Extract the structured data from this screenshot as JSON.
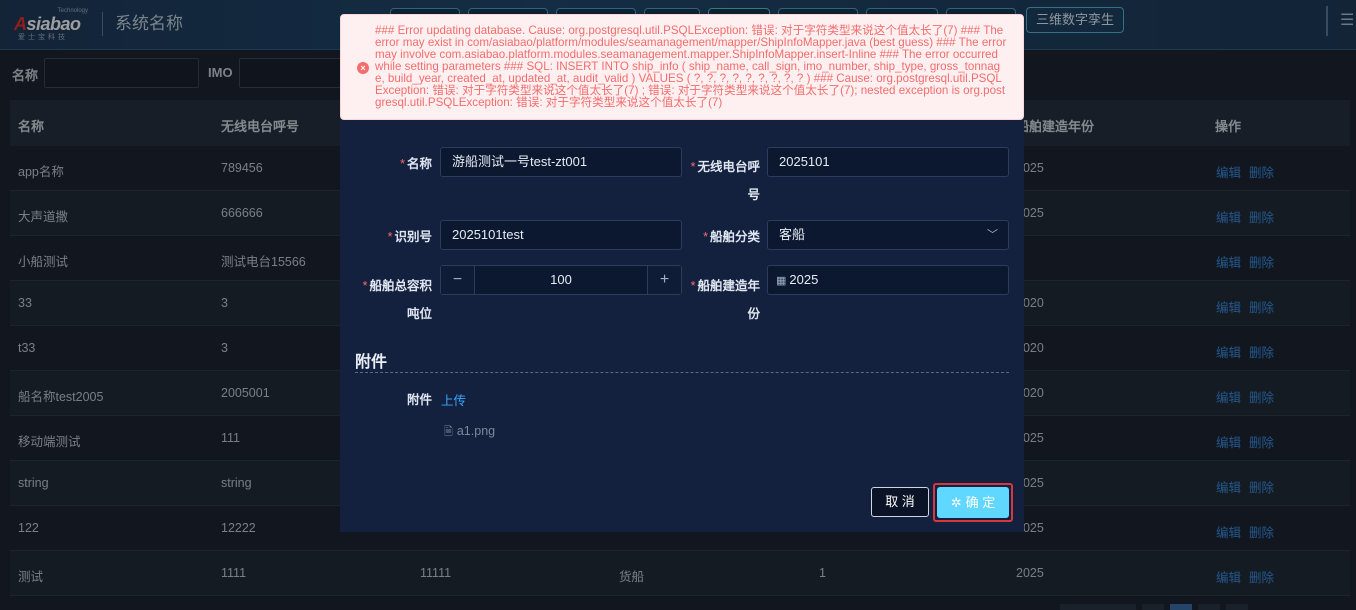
{
  "header": {
    "logo_text": "Asiabao",
    "logo_sub": "爱士宝科技",
    "logo_tech": "Technology",
    "system_name": "系统名称",
    "nav_last": "三维数字孪生"
  },
  "search": {
    "name_label": "名称",
    "imo_label": "IMO"
  },
  "table": {
    "headers": [
      "名称",
      "无线电台呼号",
      "",
      "",
      "",
      "船舶建造年份",
      "操作"
    ],
    "rows": [
      {
        "name": "app名称",
        "call": "789456",
        "year": "2025"
      },
      {
        "name": "大声道撒",
        "call": "666666",
        "year": "2025"
      },
      {
        "name": "小船测试",
        "call": "测试电台15566",
        "year": ""
      },
      {
        "name": "33",
        "call": "3",
        "year": "2020"
      },
      {
        "name": "t33",
        "call": "3",
        "year": "2020"
      },
      {
        "name": "船名称test2005",
        "call": "2005001",
        "year": "2020"
      },
      {
        "name": "移动端测试",
        "call": "111",
        "year": "2025"
      },
      {
        "name": "string",
        "call": "string",
        "year": "2025"
      },
      {
        "name": "122",
        "call": "12222",
        "year": "2025"
      }
    ],
    "last_row": {
      "name": "测试",
      "call": "1111",
      "id": "11111",
      "type": "货船",
      "tonnage": "1",
      "year": "2025"
    },
    "edit_label": "编辑",
    "delete_label": "删除"
  },
  "dialog": {
    "name_label": "名称",
    "name_value": "游船测试一号test-zt001",
    "call_label_1": "无线电台呼",
    "call_label_2": "号",
    "call_value": "2025101",
    "id_label": "识别号",
    "id_value": "2025101test",
    "type_label": "船舶分类",
    "type_value": "客船",
    "tonnage_label_1": "船舶总容积",
    "tonnage_label_2": "吨位",
    "tonnage_value": "100",
    "year_label_1": "船舶建造年",
    "year_label_2": "份",
    "year_value": "2025",
    "section_title": "附件",
    "attach_label": "附件",
    "upload_label": "上传",
    "file_name": "a1.png",
    "cancel_label": "取 消",
    "ok_label": "确 定"
  },
  "alert": {
    "message": "### Error updating database. Cause: org.postgresql.util.PSQLException: 错误: 对于字符类型来说这个值太长了(7) ### The error may exist in com/asiabao/platform/modules/seamanagement/mapper/ShipInfoMapper.java (best guess) ### The error may involve com.asiabao.platform.modules.seamanagement.mapper.ShipInfoMapper.insert-Inline ### The error occurred while setting parameters ### SQL: INSERT INTO ship_info ( ship_name, call_sign, imo_number, ship_type, gross_tonnage, build_year, created_at, updated_at, audit_valid ) VALUES ( ?, ?, ?, ?, ?, ?, ?, ?, ? ) ### Cause: org.postgresql.util.PSQLException: 错误: 对于字符类型来说这个值太长了(7) ; 错误: 对于字符类型来说这个值太长了(7); nested exception is org.postgresql.util.PSQLException: 错误: 对于字符类型来说这个值太长了(7)"
  },
  "colors": {
    "accent": "#5fd7ff",
    "error": "#f56c6c",
    "link": "#3a8ee6",
    "required": "#f56c6c"
  }
}
